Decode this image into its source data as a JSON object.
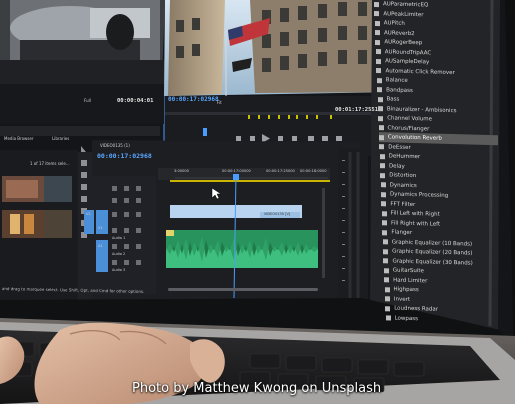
{
  "photo_credit": "Photo by Matthew Kwong on Unsplash",
  "program_monitor": {
    "timecode_current": "00:00:17:02968",
    "timecode_duration": "00:01:17:25518",
    "fit_label": "Fit"
  },
  "source_monitor": {
    "fit_label": "Full",
    "timecode": "00:00:04:01"
  },
  "project_panel": {
    "tabs": [
      "Media Browser",
      "Libraries"
    ],
    "item_count": "1 of 17 items sele..."
  },
  "timeline": {
    "sequence_name": "VIDEO0135 (1)",
    "timecode": "00:00:17:02968",
    "ruler_labels": [
      "3:00000",
      "00:00:17:00000",
      "00:00:17:25000",
      "00:00:18:0000"
    ],
    "clip_label": "VIDEO0135 [V]",
    "tracks": [
      "V2",
      "V1",
      "A1",
      "Audio 1",
      "Audio 2",
      "Audio 3"
    ],
    "hint": "and drag to marquee select. Use Shift, Opt, and Cmd for other options."
  },
  "effects_panel": {
    "items": [
      "AUParametricEQ",
      "AUPeakLimiter",
      "AUPitch",
      "AUReverb2",
      "AURogerBeep",
      "AURoundTripAAC",
      "AUSampleDelay",
      "Automatic Click Remover",
      "Balance",
      "Bandpass",
      "Bass",
      "Binauralizer - Ambisonics",
      "Channel Volume",
      "Chorus/Flanger",
      "Convolution Reverb",
      "DeEsser",
      "DeHummer",
      "Delay",
      "Distortion",
      "Dynamics",
      "Dynamics Processing",
      "FFT Filter",
      "Fill Left with Right",
      "Fill Right with Left",
      "Flanger",
      "Graphic Equalizer (10 Bands)",
      "Graphic Equalizer (20 Bands)",
      "Graphic Equalizer (30 Bands)",
      "GuitarSuite",
      "Hard Limiter",
      "Highpass",
      "Invert",
      "Loudness Radar",
      "Lowpass"
    ],
    "selected": "Convolution Reverb"
  },
  "colors": {
    "accent_blue": "#4a9dff",
    "audio_green": "#2ea66c",
    "video_clip": "#b7d3ef",
    "panel_dark": "#1e1f22"
  }
}
